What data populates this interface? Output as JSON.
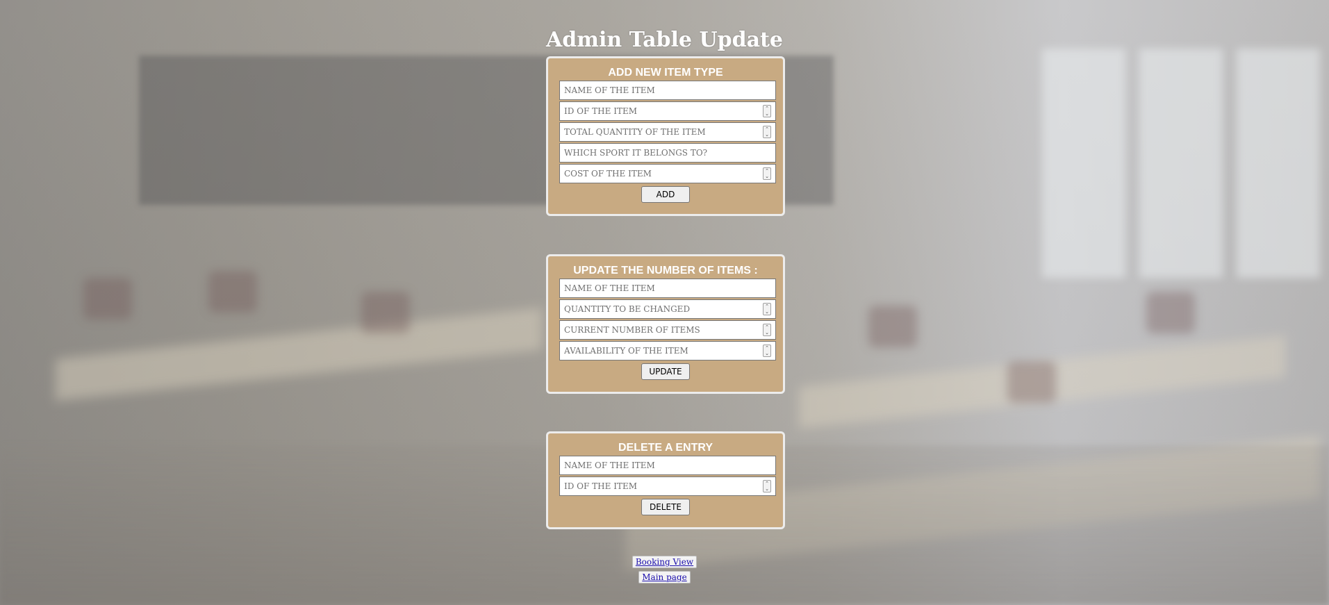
{
  "page": {
    "title": "Admin Table Update"
  },
  "add_panel": {
    "heading": "ADD NEW ITEM TYPE",
    "fields": [
      {
        "placeholder": "NAME OF THE ITEM",
        "type": "text"
      },
      {
        "placeholder": "ID OF THE ITEM",
        "type": "number"
      },
      {
        "placeholder": "TOTAL QUANTITY OF THE ITEM",
        "type": "number"
      },
      {
        "placeholder": "WHICH SPORT IT BELONGS TO?",
        "type": "text"
      },
      {
        "placeholder": "COST OF THE ITEM",
        "type": "number"
      }
    ],
    "button_label": "ADD"
  },
  "update_panel": {
    "heading": "UPDATE THE NUMBER OF ITEMS :",
    "fields": [
      {
        "placeholder": "NAME OF THE ITEM",
        "type": "text"
      },
      {
        "placeholder": "QUANTITY TO BE CHANGED",
        "type": "number"
      },
      {
        "placeholder": "CURRENT NUMBER OF ITEMS",
        "type": "number"
      },
      {
        "placeholder": "AVAILABILITY OF THE ITEM",
        "type": "number"
      }
    ],
    "button_label": "UPDATE"
  },
  "delete_panel": {
    "heading": "DELETE A ENTRY",
    "fields": [
      {
        "placeholder": "NAME OF THE ITEM",
        "type": "text"
      },
      {
        "placeholder": "ID OF THE ITEM",
        "type": "number"
      }
    ],
    "button_label": "DELETE"
  },
  "links": {
    "booking_view": "Booking View",
    "main_page": "Main page"
  },
  "colors": {
    "panel_background": "#c8aa82",
    "panel_border": "#ececec",
    "heading_text": "#ffffff"
  },
  "icons": {
    "number_spinner": "spinner-icon"
  }
}
